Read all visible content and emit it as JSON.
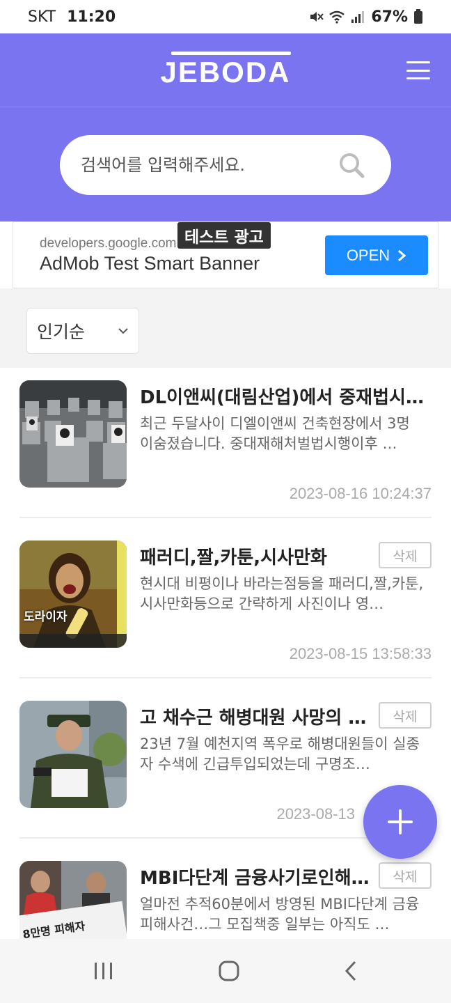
{
  "status_bar": {
    "carrier": "SKT",
    "time": "11:20",
    "battery": "67%"
  },
  "header": {
    "logo": "JEBODA"
  },
  "search": {
    "placeholder": "검색어를 입력해주세요."
  },
  "ad": {
    "label": "테스트 광고",
    "url": "developers.google.com",
    "title": "AdMob Test Smart Banner",
    "button": "OPEN"
  },
  "sort": {
    "selected": "인기순"
  },
  "posts": [
    {
      "title": "DL이앤씨(대림산업)에서 중재법시행이후",
      "desc": "최근 두달사이 디엘이앤씨 건축현장에서 3명 이숨졌습니다. 중대재해처벌법시행이후 …",
      "date": "2023-08-16 10:24:37"
    },
    {
      "title": "패러디,짤,카툰,시사만화",
      "desc": "현시대 비평이나 바라는점등을 패러디,짤,카툰,시사만화등으로 간략하게 사진이나 영…",
      "date": "2023-08-15 13:58:33",
      "delete": "삭제",
      "thumb_caption": "도라이자"
    },
    {
      "title": "고 채수근 해병대원 사망의 …",
      "desc": "23년 7월 예천지역 폭우로 해병대원들이 실종자 수색에 긴급투입되었는데 구명조…",
      "date": "2023-08-13",
      "delete": "삭제"
    },
    {
      "title": "MBI다단계 금융사기로인해…",
      "desc": "얼마전 추적60분에서 방영된 MBI다단계 금융피해사건…그 모집책중 일부는 아직도 …",
      "delete": "삭제",
      "thumb_text": "8만명 피해자"
    }
  ],
  "colors": {
    "brand": "#7b74f0",
    "ad_button": "#1a8cff"
  }
}
